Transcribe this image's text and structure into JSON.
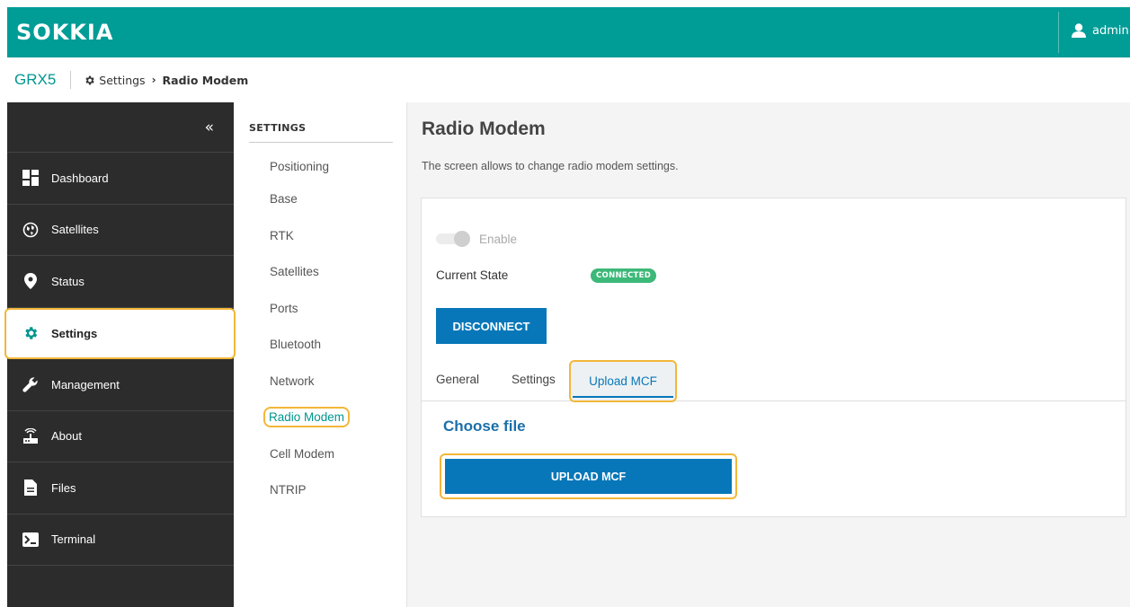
{
  "header": {
    "logo": "SOKKIA",
    "user": "admin"
  },
  "breadcrumb": {
    "device": "GRX5",
    "parent": "Settings",
    "current": "Radio Modem"
  },
  "sidebar": {
    "collapse_glyph": "«",
    "items": [
      {
        "label": "Dashboard",
        "icon": "dashboard-icon"
      },
      {
        "label": "Satellites",
        "icon": "globe-icon"
      },
      {
        "label": "Status",
        "icon": "location-pin-icon"
      },
      {
        "label": "Settings",
        "icon": "gear-icon"
      },
      {
        "label": "Management",
        "icon": "wrench-icon"
      },
      {
        "label": "About",
        "icon": "receiver-icon"
      },
      {
        "label": "Files",
        "icon": "file-icon"
      },
      {
        "label": "Terminal",
        "icon": "terminal-icon"
      }
    ]
  },
  "submenu": {
    "title": "SETTINGS",
    "items": [
      "Positioning",
      "Base",
      "RTK",
      "Satellites",
      "Ports",
      "Bluetooth",
      "Network",
      "Radio Modem",
      "Cell Modem",
      "NTRIP"
    ]
  },
  "main": {
    "title": "Radio Modem",
    "description": "The screen allows to change radio modem settings.",
    "enable_label": "Enable",
    "enable_state": "off",
    "state_label": "Current State",
    "state_badge": "CONNECTED",
    "disconnect_label": "DISCONNECT",
    "tabs": [
      "General",
      "Settings",
      "Upload MCF"
    ],
    "active_tab": "Upload MCF",
    "choose_file_label": "Choose file",
    "upload_label": "UPLOAD MCF"
  },
  "colors": {
    "brand_teal": "#009c96",
    "primary_blue": "#0877b9",
    "success_green": "#3cb878",
    "highlight_orange": "#f3b739",
    "sidebar_dark": "#2c2c2c"
  }
}
